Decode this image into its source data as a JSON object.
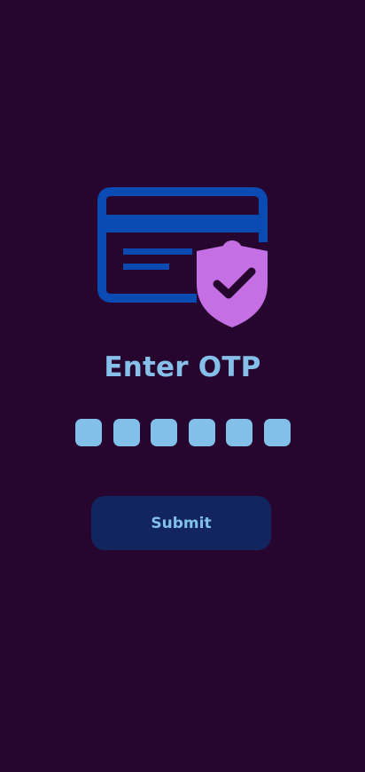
{
  "colors": {
    "background": "#26062e",
    "card_icon": "#0a4bb3",
    "shield_icon": "#c56fe4",
    "shield_check": "#26062e",
    "title": "#86bfea",
    "otp_box": "#82c0ea",
    "button_bg": "#13255f",
    "button_text": "#82c0ea"
  },
  "hero": {
    "icon": "credit-card-shield-icon"
  },
  "title": "Enter OTP",
  "otp": {
    "length": 6,
    "values": [
      "",
      "",
      "",
      "",
      "",
      ""
    ]
  },
  "submit": {
    "label": "Submit"
  }
}
